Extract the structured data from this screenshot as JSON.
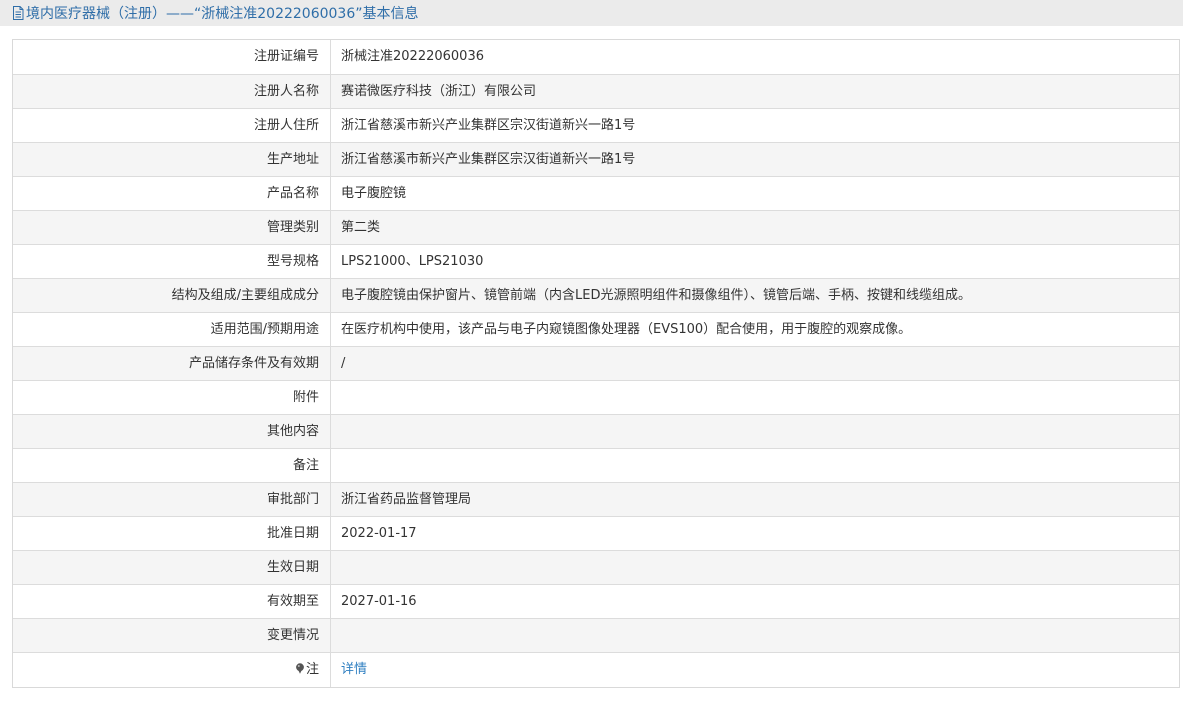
{
  "header": {
    "title": "境内医疗器械（注册）——“浙械注准20222060036”基本信息",
    "icon": "document-icon"
  },
  "rows": [
    {
      "label": "注册证编号",
      "value": "浙械注准20222060036"
    },
    {
      "label": "注册人名称",
      "value": "赛诺微医疗科技（浙江）有限公司"
    },
    {
      "label": "注册人住所",
      "value": "浙江省慈溪市新兴产业集群区宗汉街道新兴一路1号"
    },
    {
      "label": "生产地址",
      "value": "浙江省慈溪市新兴产业集群区宗汉街道新兴一路1号"
    },
    {
      "label": "产品名称",
      "value": "电子腹腔镜"
    },
    {
      "label": "管理类别",
      "value": "第二类"
    },
    {
      "label": "型号规格",
      "value": "LPS21000、LPS21030"
    },
    {
      "label": "结构及组成/主要组成成分",
      "value": "电子腹腔镜由保护窗片、镜管前端（内含LED光源照明组件和摄像组件）、镜管后端、手柄、按键和线缆组成。"
    },
    {
      "label": "适用范围/预期用途",
      "value": "在医疗机构中使用，该产品与电子内窥镜图像处理器（EVS100）配合使用，用于腹腔的观察成像。"
    },
    {
      "label": "产品储存条件及有效期",
      "value": "/"
    },
    {
      "label": "附件",
      "value": ""
    },
    {
      "label": "其他内容",
      "value": ""
    },
    {
      "label": "备注",
      "value": ""
    },
    {
      "label": "审批部门",
      "value": "浙江省药品监督管理局"
    },
    {
      "label": "批准日期",
      "value": "2022-01-17"
    },
    {
      "label": "生效日期",
      "value": ""
    },
    {
      "label": "有效期至",
      "value": "2027-01-16"
    },
    {
      "label": "变更情况",
      "value": ""
    }
  ],
  "note_row": {
    "label": "注",
    "icon": "pin-icon",
    "link_text": "详情",
    "link_color": "#2f7fc1"
  },
  "colors": {
    "header_bg": "#ebebeb",
    "header_text": "#2f6ea8",
    "row_alt_bg": "#f5f5f5",
    "border": "#dcdcdc"
  }
}
